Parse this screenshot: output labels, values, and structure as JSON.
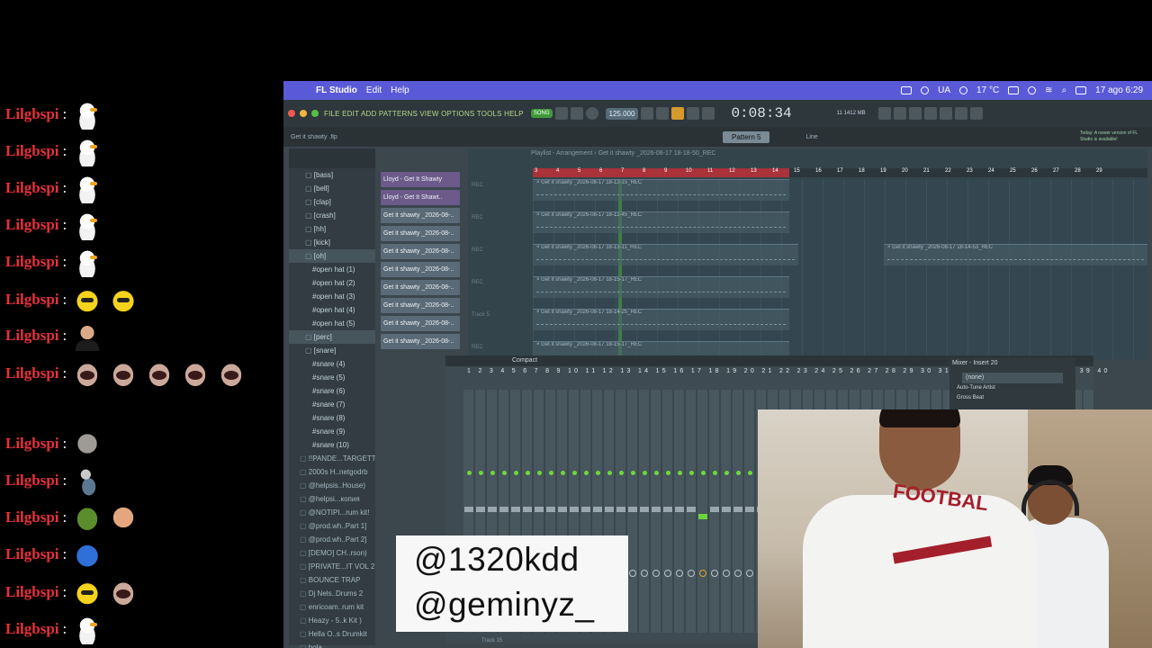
{
  "chat": {
    "username": "Lilgbspi",
    "separator": ":",
    "rows": [
      {
        "emotes": [
          "goose-icon"
        ]
      },
      {
        "emotes": [
          "goose-icon"
        ]
      },
      {
        "emotes": [
          "goose-icon"
        ]
      },
      {
        "emotes": [
          "goose-icon"
        ]
      },
      {
        "emotes": [
          "goose-icon"
        ]
      },
      {
        "emotes": [
          "yellow-face-icon",
          "yellow-face-icon"
        ]
      },
      {
        "emotes": [
          "man-face-icon"
        ]
      },
      {
        "emotes": [
          "cat-icon",
          "cat-icon",
          "cat-icon",
          "cat-icon",
          "cat-icon",
          "cat-icon",
          "cat-icon",
          "cat-icon",
          "cat-icon",
          "cat-icon",
          "cat-icon",
          "cat-icon",
          "cat-icon"
        ]
      },
      {
        "emotes": [
          "otter-icon"
        ]
      },
      {
        "emotes": [
          "figure-icon"
        ]
      },
      {
        "emotes": [
          "pepe-icon",
          "face-icon"
        ]
      },
      {
        "emotes": [
          "blue-cat-icon"
        ]
      },
      {
        "emotes": [
          "yellow-face-icon",
          "cat-icon"
        ]
      },
      {
        "emotes": [
          "goose-icon"
        ]
      }
    ]
  },
  "menubar": {
    "app_name": "FL Studio",
    "menus": [
      "Edit",
      "Help"
    ],
    "language": "UA",
    "temperature": "17 °C",
    "datetime": "17 ago 6:29"
  },
  "toolbar": {
    "menus": "FILE EDIT ADD PATTERNS VIEW OPTIONS TOOLS HELP",
    "song_label": "SONG",
    "tempo": "125.000",
    "time": "0:08:34",
    "memory": "1412 MB",
    "cpu": "11",
    "hint": "Get it shawty .flp",
    "pattern": "Pattern 5",
    "line_label": "Line",
    "news": "Today: A newer version of FL Studio is available!"
  },
  "browser": {
    "items": [
      {
        "label": "[bass]",
        "kind": "folder"
      },
      {
        "label": "[bell]",
        "kind": "folder"
      },
      {
        "label": "[clap]",
        "kind": "folder"
      },
      {
        "label": "[crash]",
        "kind": "folder"
      },
      {
        "label": "[hh]",
        "kind": "folder"
      },
      {
        "label": "[kick]",
        "kind": "folder"
      },
      {
        "label": "[oh]",
        "kind": "folder"
      },
      {
        "label": "#open hat (1)",
        "kind": "file"
      },
      {
        "label": "#open hat (2)",
        "kind": "file"
      },
      {
        "label": "#open hat (3)",
        "kind": "file"
      },
      {
        "label": "#open hat (4)",
        "kind": "file"
      },
      {
        "label": "#open hat (5)",
        "kind": "file"
      },
      {
        "label": "[perc]",
        "kind": "folder"
      },
      {
        "label": "[snare]",
        "kind": "folder"
      },
      {
        "label": "#snare (4)",
        "kind": "file"
      },
      {
        "label": "#snare (5)",
        "kind": "file"
      },
      {
        "label": "#snare (6)",
        "kind": "file"
      },
      {
        "label": "#snare (7)",
        "kind": "file"
      },
      {
        "label": "#snare (8)",
        "kind": "file"
      },
      {
        "label": "#snare (9)",
        "kind": "file"
      },
      {
        "label": "#snare (10)",
        "kind": "file"
      },
      {
        "label": "!!PANDE...TARGETT",
        "kind": "pack"
      },
      {
        "label": "2000s H..netgodrb",
        "kind": "pack"
      },
      {
        "label": "@helpsis..House)",
        "kind": "pack"
      },
      {
        "label": "@helpsi...копия",
        "kind": "pack"
      },
      {
        "label": "@NOTIPI...rum kit!",
        "kind": "pack"
      },
      {
        "label": "@prod.wh..Part 1]",
        "kind": "pack"
      },
      {
        "label": "@prod.wh..Part 2]",
        "kind": "pack"
      },
      {
        "label": "[DEMO] CH..rson)",
        "kind": "pack"
      },
      {
        "label": "[PRIVATE...IT VOL 2",
        "kind": "pack"
      },
      {
        "label": "BOUNCE TRAP",
        "kind": "pack"
      },
      {
        "label": "Dj Nels..Drums 2",
        "kind": "pack"
      },
      {
        "label": "enricoam..rum kit",
        "kind": "pack"
      },
      {
        "label": "Heazy - 5..k Kit )",
        "kind": "pack"
      },
      {
        "label": "Hella O..s Drumkit",
        "kind": "pack"
      },
      {
        "label": "hola",
        "kind": "pack"
      }
    ]
  },
  "channels": [
    "Lloyd - Get It Shawty",
    "Lloyd - Get It Shawt..",
    "Get it shawty _2026-08-..",
    "Get it shawty _2026-08-..",
    "Get it shawty _2026-08-..",
    "Get it shawty _2026-08-..",
    "Get it shawty _2026-08-..",
    "Get it shawty _2026-08-..",
    "Get it shawty _2026-08-..",
    "Get it shawty _2026-08-.."
  ],
  "playlist": {
    "title": "Playlist - Arrangement › Get it shawty _2026-08-17 18-18-50_REC",
    "ticks": [
      "3",
      "4",
      "5",
      "6",
      "7",
      "8",
      "9",
      "10",
      "11",
      "12",
      "13",
      "14",
      "15",
      "16",
      "17",
      "18",
      "19",
      "20",
      "21",
      "22",
      "23",
      "24",
      "25",
      "26",
      "27",
      "28",
      "29"
    ],
    "clips": [
      "Get it shawty _2026-08-17 18-12-15_REC",
      "Get it shawty _2026-08-17 18-12-45_REC",
      "Get it shawty _2026-08-17 18-13-11_REC",
      "Get it shawty _2026-08-17 18-14-53_REC",
      "Get it shawty _2026-08-17 18-15-17_REC",
      "Get it shawty _2026-08-17 18-14-25_REC",
      "Get it shawty _2026-08-17 18-15-17_REC"
    ],
    "track_labels": [
      "REC",
      "REC",
      "REC",
      "REC",
      "Track 5",
      "REC"
    ]
  },
  "mixer": {
    "view_label": "Compact",
    "insert_numbers": "1 2 3 4 5 6 7 8 9 10 11 12 13 14 15 16 17 18 19 20 21 22 23 24 25 26 27 28 29 30 31 32 33 34 35 36 37 38 39 40",
    "side_title": "Mixer - Insert 20",
    "preset": "(none)",
    "slots": [
      "Auto-Tune Artist",
      "Gross Beat"
    ],
    "footer": "Track 15"
  },
  "overlay": {
    "names": [
      "@1320kdd",
      "@geminyz_"
    ]
  },
  "webcam": {
    "shirt_text": "FOOTBAL"
  }
}
